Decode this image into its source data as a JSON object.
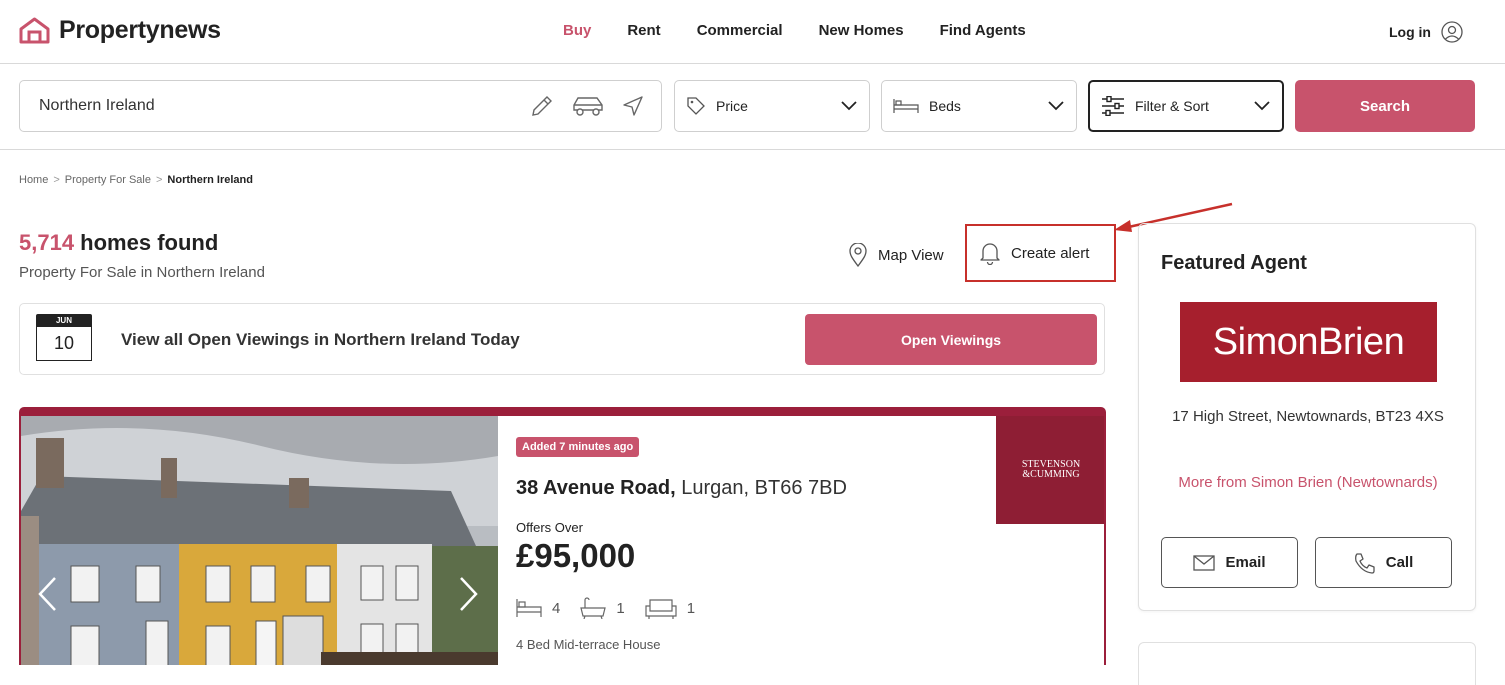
{
  "header": {
    "logo_text": "Propertynews",
    "nav": [
      "Buy",
      "Rent",
      "Commercial",
      "New Homes",
      "Find Agents"
    ],
    "login": "Log in"
  },
  "search": {
    "location_value": "Northern Ireland",
    "price_label": "Price",
    "beds_label": "Beds",
    "filter_label": "Filter & Sort",
    "search_button": "Search"
  },
  "breadcrumb": {
    "home": "Home",
    "sale": "Property For Sale",
    "current": "Northern Ireland"
  },
  "results": {
    "count": "5,714",
    "count_suffix": " homes found",
    "subtitle": "Property For Sale in Northern Ireland",
    "map_view": "Map View",
    "create_alert": "Create alert"
  },
  "viewings": {
    "month": "JUN",
    "day": "10",
    "text": "View all Open Viewings in Northern Ireland Today",
    "button": "Open Viewings"
  },
  "listing": {
    "badge": "Added 7 minutes ago",
    "address_bold": "38 Avenue Road,",
    "address_rest": " Lurgan, BT66 7BD",
    "offers": "Offers Over",
    "price": "£95,000",
    "beds": "4",
    "baths": "1",
    "receptions": "1",
    "type": "4 Bed Mid-terrace House",
    "agent_logo_line1": "STEVENSON",
    "agent_logo_line2": "&CUMMING"
  },
  "featured_agent": {
    "heading": "Featured Agent",
    "logo_text": "SimonBrien",
    "address": "17 High Street, Newtownards, BT23 4XS",
    "more": "More from Simon Brien (Newtownards)",
    "email": "Email",
    "call": "Call"
  },
  "colors": {
    "accent": "#c8536c",
    "card_border": "#9b1f3b",
    "simon_brien": "#a61f2d",
    "annotation_red": "#c7302b"
  }
}
